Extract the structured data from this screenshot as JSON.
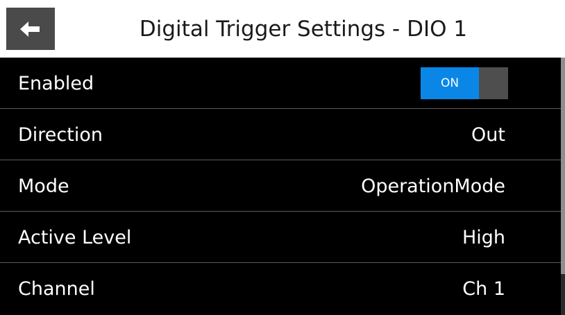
{
  "header": {
    "title": "Digital Trigger Settings - DIO 1",
    "back_icon": "arrow-left-icon"
  },
  "settings": {
    "enabled": {
      "label": "Enabled",
      "toggle_text": "ON",
      "state": true
    },
    "direction": {
      "label": "Direction",
      "value": "Out"
    },
    "mode": {
      "label": "Mode",
      "value": "OperationMode"
    },
    "active_level": {
      "label": "Active Level",
      "value": "High"
    },
    "channel": {
      "label": "Channel",
      "value": "Ch 1"
    }
  },
  "colors": {
    "header_bg": "#ffffff",
    "list_bg": "#000000",
    "accent": "#0a87e6",
    "back_button_bg": "#4a4a4a"
  }
}
